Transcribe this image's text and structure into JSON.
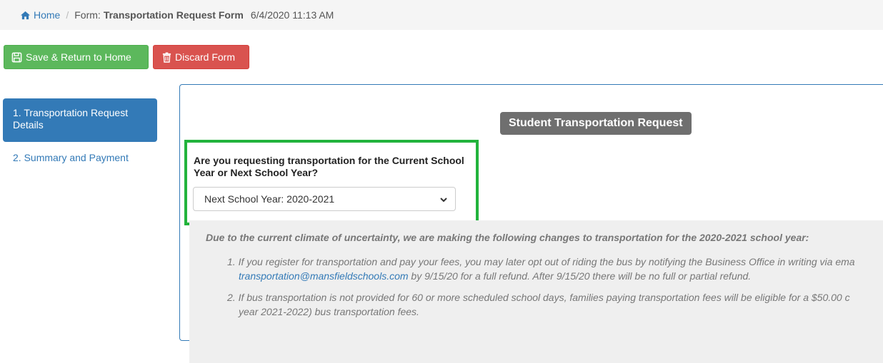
{
  "breadcrumb": {
    "home": "Home",
    "separator": "/",
    "form_prefix": "Form:",
    "form_name": "Transportation Request Form",
    "timestamp": "6/4/2020 11:13 AM"
  },
  "toolbar": {
    "save_label": "Save & Return to Home",
    "discard_label": "Discard Form"
  },
  "sidebar": {
    "items": [
      {
        "label": "1. Transportation Request Details",
        "active": true
      },
      {
        "label": "2. Summary and Payment",
        "active": false
      }
    ]
  },
  "panel": {
    "heading": "Student Transportation Request",
    "question": "Are you requesting transportation for the Current School Year or Next School Year?",
    "select_value": "Next School Year: 2020-2021",
    "notice": {
      "intro": "Due to the current climate of uncertainty, we are making the following changes to transportation for the 2020-2021 school year:",
      "item1_a": "1. If you register for transportation and pay your fees, you may later opt out of riding the bus by notifying the Business Office in writing via ema",
      "item1_email": "transportation@mansfieldschools.com",
      "item1_b": " by 9/15/20 for a full refund. After 9/15/20 there will be no full or partial refund.",
      "item2_a": "2. If bus transportation is not provided for 60 or more scheduled school days, families paying transportation fees will be eligible for a $50.00 c",
      "item2_b": "year 2021-2022) bus transportation fees."
    }
  },
  "colors": {
    "primary": "#337ab7",
    "success": "#5cb85c",
    "danger": "#d9534f",
    "highlight": "#22b33c",
    "heading_bg": "#6f6f6f"
  },
  "icons": {
    "home": "home-icon",
    "save": "floppy-disk-icon",
    "discard": "trash-icon",
    "select": "chevron-down-icon"
  }
}
